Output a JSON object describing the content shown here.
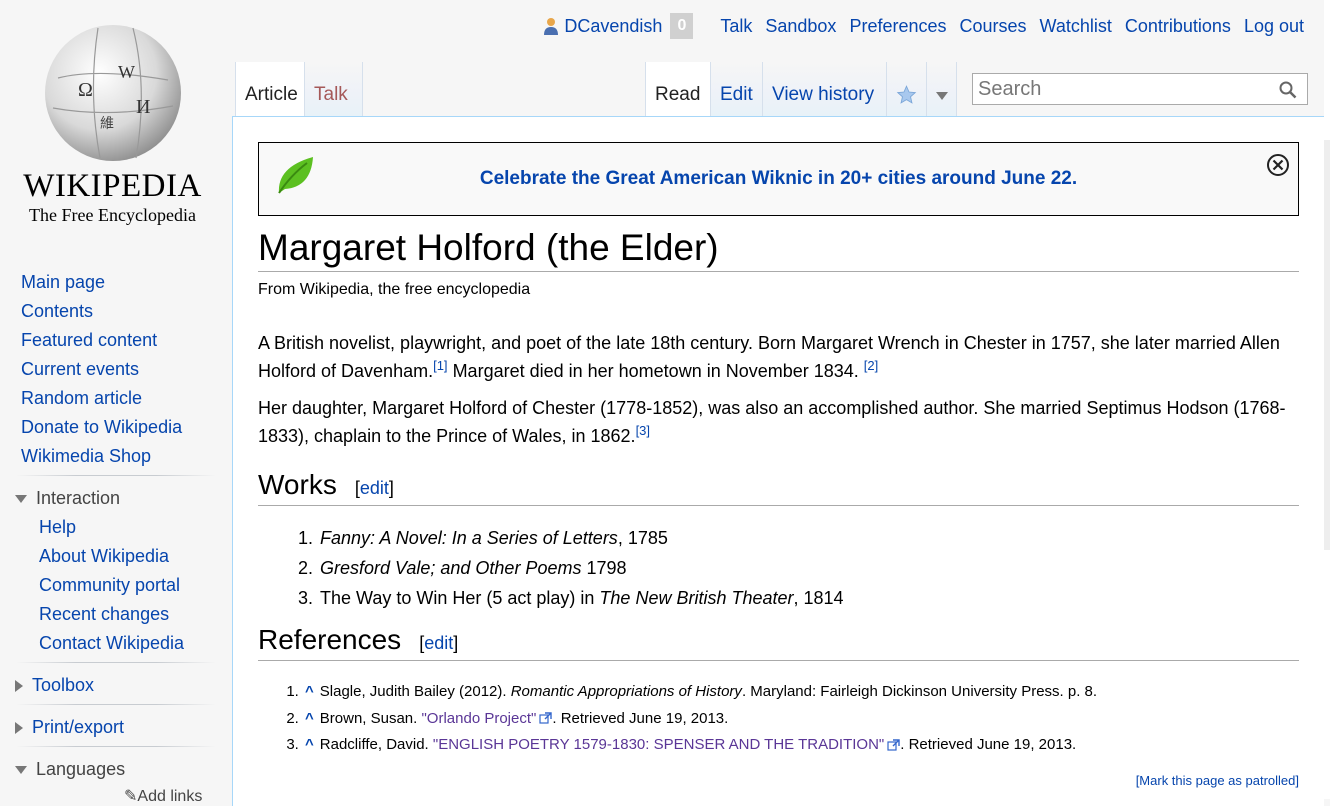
{
  "logo": {
    "wordmark": "WIKIPEDIA",
    "tagline": "The Free Encyclopedia"
  },
  "personal": {
    "username": "DCavendish",
    "notifications": "0",
    "links": [
      "Talk",
      "Sandbox",
      "Preferences",
      "Courses",
      "Watchlist",
      "Contributions",
      "Log out"
    ]
  },
  "tabs": {
    "article": "Article",
    "talk": "Talk",
    "read": "Read",
    "edit": "Edit",
    "history": "View history"
  },
  "search": {
    "placeholder": "Search"
  },
  "sidebar": {
    "nav": [
      "Main page",
      "Contents",
      "Featured content",
      "Current events",
      "Random article",
      "Donate to Wikipedia",
      "Wikimedia Shop"
    ],
    "interaction": {
      "heading": "Interaction",
      "items": [
        "Help",
        "About Wikipedia",
        "Community portal",
        "Recent changes",
        "Contact Wikipedia"
      ]
    },
    "toolbox": "Toolbox",
    "print": "Print/export",
    "languages": "Languages",
    "add_links": "Add links"
  },
  "banner": {
    "message": "Celebrate the Great American Wiknic in 20+ cities around June 22."
  },
  "article": {
    "title": "Margaret Holford (the Elder)",
    "tagline": "From Wikipedia, the free encyclopedia",
    "p1_a": "A British novelist, playwright, and poet of the late 18th century. Born Margaret Wrench in Chester in 1757, she later married Allen Holford of Davenham.",
    "p1_ref1": "[1]",
    "p1_b": " Margaret died in her hometown in November 1834. ",
    "p1_ref2": "[2]",
    "p2_a": "Her daughter, Margaret Holford of Chester (1778-1852), was also an accomplished author. She married Septimus Hodson (1768-1833), chaplain to the Prince of Wales, in 1862.",
    "p2_ref3": "[3]",
    "works_heading": "Works",
    "references_heading": "References",
    "edit_open": "[",
    "edit_label": "edit",
    "edit_close": "]",
    "works": [
      {
        "title": "Fanny: A Novel: In a Series of Letters",
        "rest": ", 1785"
      },
      {
        "title": "Gresford Vale; and Other Poems",
        "rest": " 1798"
      },
      {
        "pre": "The Way to Win Her (5 act play) in ",
        "title": "The New British Theater",
        "rest": ", 1814"
      }
    ],
    "references": [
      {
        "caret": "^",
        "pre": "Slagle, Judith Bailey (2012). ",
        "title": "Romantic Appropriations of History",
        "rest": ". Maryland: Fairleigh Dickinson University Press. p. 8."
      },
      {
        "caret": "^",
        "pre": "Brown, Susan. ",
        "link": "\"Orlando Project\"",
        "rest": ". Retrieved June 19, 2013."
      },
      {
        "caret": "^",
        "pre": "Radcliffe, David. ",
        "link": "\"ENGLISH POETRY 1579-1830: SPENSER AND THE TRADITION\"",
        "rest": ". Retrieved June 19, 2013."
      }
    ],
    "patrol": "[Mark this page as patrolled]"
  }
}
